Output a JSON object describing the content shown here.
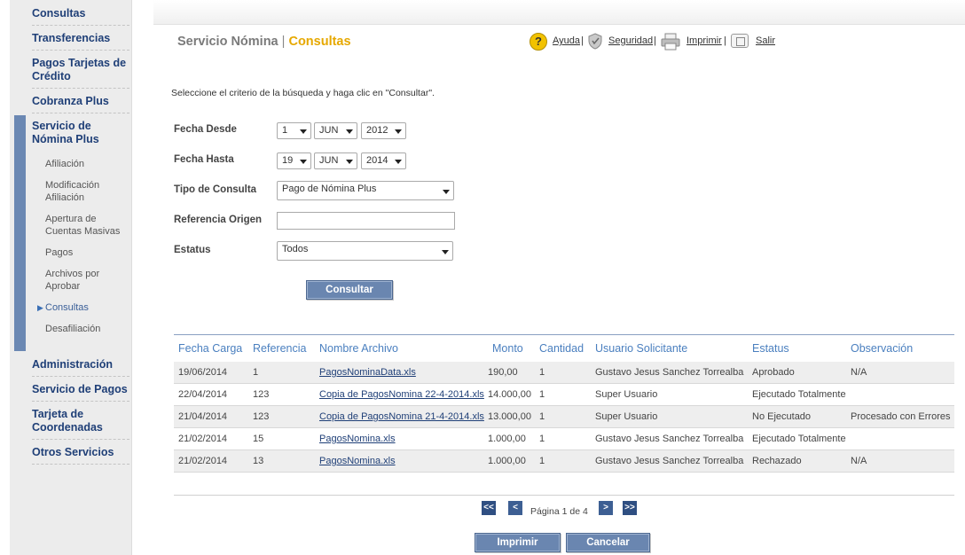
{
  "sidebar": {
    "main_items": [
      {
        "label": "Consultas"
      },
      {
        "label": "Transferencias"
      },
      {
        "label": "Pagos Tarjetas de Crédito"
      },
      {
        "label": "Cobranza Plus"
      },
      {
        "label": "Servicio de Nómina Plus"
      },
      {
        "label": "Administración"
      },
      {
        "label": "Servicio de Pagos"
      },
      {
        "label": "Tarjeta de Coordenadas"
      },
      {
        "label": "Otros Servicios"
      }
    ],
    "sub_items": [
      {
        "label": "Afiliación"
      },
      {
        "label": "Modificación Afiliación"
      },
      {
        "label": "Apertura de Cuentas Masivas"
      },
      {
        "label": "Pagos"
      },
      {
        "label": "Archivos por Aprobar"
      },
      {
        "label": "Consultas"
      },
      {
        "label": "Desafiliación"
      }
    ],
    "active_sub": "Consultas",
    "accent_color": "#6b88b3"
  },
  "header": {
    "service": "Servicio Nómina",
    "separator": "|",
    "section": "Consultas",
    "links": {
      "help": "Ayuda",
      "security": "Seguridad",
      "print": "Imprimir",
      "exit": "Salir"
    },
    "pipe": "|"
  },
  "instruction": "Seleccione el criterio de la búsqueda y haga clic en \"Consultar\".",
  "form": {
    "fecha_desde": {
      "label": "Fecha Desde",
      "day": "1",
      "month": "JUN",
      "year": "2012"
    },
    "fecha_hasta": {
      "label": "Fecha Hasta",
      "day": "19",
      "month": "JUN",
      "year": "2014"
    },
    "tipo_consulta": {
      "label": "Tipo de Consulta",
      "value": "Pago de Nómina Plus"
    },
    "referencia_origen": {
      "label": "Referencia Origen",
      "value": ""
    },
    "estatus": {
      "label": "Estatus",
      "value": "Todos"
    },
    "consultar_label": "Consultar"
  },
  "table": {
    "headers": [
      "Fecha Carga",
      "Referencia",
      "Nombre Archivo",
      "Monto",
      "Cantidad",
      "Usuario Solicitante",
      "Estatus",
      "Observación"
    ],
    "rows": [
      [
        "19/06/2014",
        "1",
        "PagosNominaData.xls",
        "190,00",
        "1",
        "Gustavo Jesus Sanchez Torrealba",
        "Aprobado",
        "N/A"
      ],
      [
        "22/04/2014",
        "123",
        "Copia de PagosNomina 22-4-2014.xls",
        "14.000,00",
        "1",
        "Super Usuario",
        "Ejecutado Totalmente",
        ""
      ],
      [
        "21/04/2014",
        "123",
        "Copia de PagosNomina 21-4-2014.xls",
        "13.000,00",
        "1",
        "Super Usuario",
        "No Ejecutado",
        "Procesado con Errores"
      ],
      [
        "21/02/2014",
        "15",
        "PagosNomina.xls",
        "1.000,00",
        "1",
        "Gustavo Jesus Sanchez Torrealba",
        "Ejecutado Totalmente",
        ""
      ],
      [
        "21/02/2014",
        "13",
        "PagosNomina.xls",
        "1.000,00",
        "1",
        "Gustavo Jesus Sanchez Torrealba",
        "Rechazado",
        "N/A"
      ]
    ]
  },
  "pager": {
    "first": "<<",
    "prev": "<",
    "next": ">",
    "last": ">>",
    "info": "Página 1 de 4"
  },
  "actions": {
    "print_label": "Imprimir",
    "cancel_label": "Cancelar"
  }
}
